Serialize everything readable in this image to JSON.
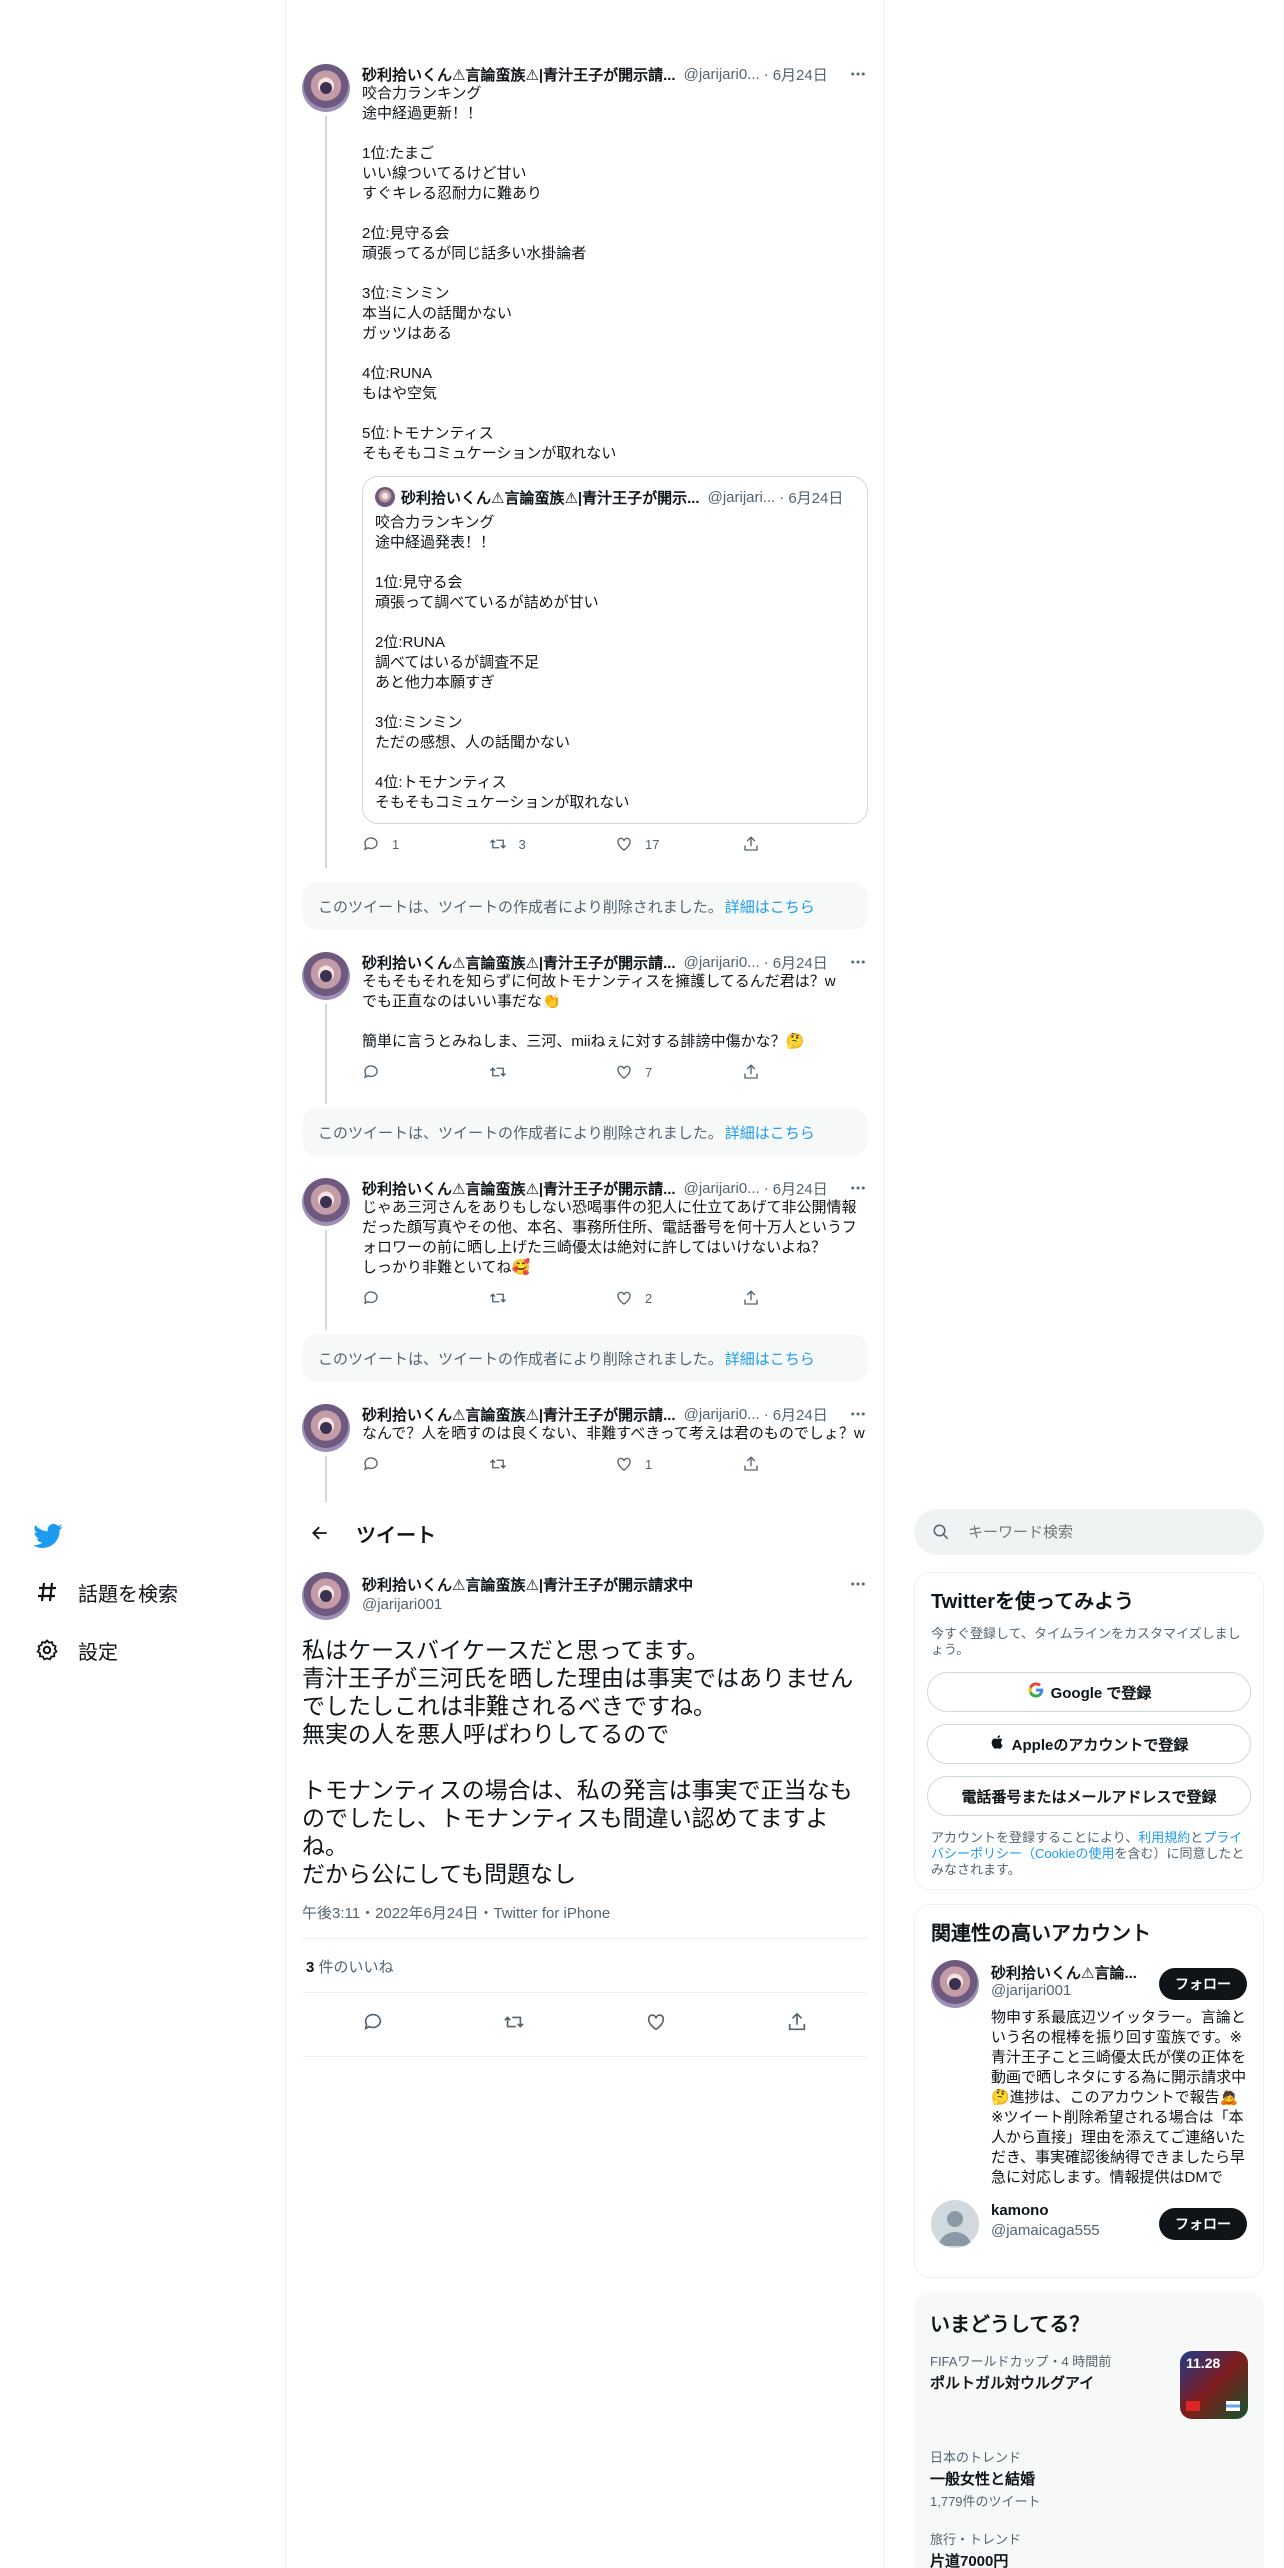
{
  "nav": {
    "explore_label": "話題を検索",
    "settings_label": "設定"
  },
  "thread": [
    {
      "name": "砂利拾いくん⚠言論蛮族⚠|青汁王子が開示請...",
      "handle": "@jarijari0...",
      "date": "6月24日",
      "text": "咬合力ランキング\n途中経過更新！！\n\n1位:たまご\nいい線ついてるけど甘い\nすぐキレる忍耐力に難あり\n\n2位:見守る会\n頑張ってるが同じ話多い水掛論者\n\n3位:ミンミン\n本当に人の話聞かない\nガッツはある\n\n4位:RUNA\nもはや空気\n\n5位:トモナンティス\nそもそもコミュケーションが取れない",
      "quote": {
        "name": "砂利拾いくん⚠言論蛮族⚠|青汁王子が開示...",
        "handle": "@jarijari...",
        "date": "6月24日",
        "text": "咬合力ランキング\n途中経過発表！！\n\n1位:見守る会\n頑張って調べているが詰めが甘い\n\n2位:RUNA\n調べてはいるが調査不足\nあと他力本願すぎ\n\n3位:ミンミン\nただの感想、人の話聞かない\n\n4位:トモナンティス\nそもそもコミュケーションが取れない"
      },
      "replies": "1",
      "retweets": "3",
      "likes": "17"
    },
    {
      "name": "砂利拾いくん⚠言論蛮族⚠|青汁王子が開示請...",
      "handle": "@jarijari0...",
      "date": "6月24日",
      "text": "そもそもそれを知らずに何故トモナンティスを擁護してるんだ君は？w\nでも正直なのはいい事だな👏\n\n簡単に言うとみねしま、三河、miiねぇに対する誹謗中傷かな？🤔",
      "replies": "",
      "retweets": "",
      "likes": "7"
    },
    {
      "name": "砂利拾いくん⚠言論蛮族⚠|青汁王子が開示請...",
      "handle": "@jarijari0...",
      "date": "6月24日",
      "text": "じゃあ三河さんをありもしない恐喝事件の犯人に仕立てあげて非公開情報だった顔写真やその他、本名、事務所住所、電話番号を何十万人というフォロワーの前に晒し上げた三崎優太は絶対に許してはいけないよね？\nしっかり非難といてね🥰",
      "replies": "",
      "retweets": "",
      "likes": "2"
    },
    {
      "name": "砂利拾いくん⚠言論蛮族⚠|青汁王子が開示請...",
      "handle": "@jarijari0...",
      "date": "6月24日",
      "text": "なんで？人を晒すのは良くない、非難すべきって考えは君のものでしょ？w",
      "replies": "",
      "retweets": "",
      "likes": "1"
    }
  ],
  "deleted_notice": {
    "text": "このツイートは、ツイートの作成者により削除されました。",
    "link": "詳細はこちら"
  },
  "detail": {
    "header_title": "ツイート",
    "name": "砂利拾いくん⚠言論蛮族⚠|青汁王子が開示請求中",
    "handle": "@jarijari001",
    "text": "私はケースバイケースだと思ってます。\n青汁王子が三河氏を晒した理由は事実ではありませんでしたしこれは非難されるべきですね。\n無実の人を悪人呼ばわりしてるので\n\nトモナンティスの場合は、私の発言は事実で正当なものでしたし、トモナンティスも間違い認めてますよね。\nだから公にしても問題なし",
    "meta": "午後3:11・2022年6月24日・Twitter for iPhone",
    "like_count": "3",
    "like_label": " 件のいいね"
  },
  "sidebar": {
    "search_placeholder": "キーワード検索",
    "signup": {
      "title": "Twitterを使ってみよう",
      "subtitle": "今すぐ登録して、タイムラインをカスタマイズしましょう。",
      "google": "Google で登録",
      "apple": "Appleのアカウントで登録",
      "phone": "電話番号またはメールアドレスで登録",
      "terms_pre": "アカウントを登録することにより、",
      "terms_link1": "利用規約",
      "terms_mid": "と",
      "terms_link2": "プライバシーポリシー（Cookieの使用",
      "terms_post": "を含む）に同意したとみなされます。"
    },
    "related": {
      "title": "関連性の高いアカウント",
      "accounts": [
        {
          "name": "砂利拾いくん⚠言論...",
          "handle": "@jarijari001",
          "follow": "フォロー",
          "bio": "物申す系最底辺ツイッタラー。言論という名の棍棒を振り回す蛮族です。※青汁王子こと三崎優太氏が僕の正体を動画で晒しネタにする為に開示請求中🤔進捗は、このアカウントで報告🙇※ツイート削除希望される場合は「本人から直接」理由を添えてご連絡いただき、事実確認後納得できましたら早急に対応します。情報提供はDMで"
        },
        {
          "name": "kamono",
          "handle": "@jamaicaga555",
          "follow": "フォロー",
          "bio": ""
        }
      ]
    },
    "trends": {
      "title": "いまどうしてる？",
      "items": [
        {
          "meta": "FIFAワールドカップ・4 時間前",
          "title": "ポルトガル対ウルグアイ",
          "count": "",
          "image_text": "11.28"
        },
        {
          "meta": "日本のトレンド",
          "title": "一般女性と結婚",
          "count": "1,779件のツイート"
        },
        {
          "meta": "旅行・トレンド",
          "title": "片道7000円",
          "count": ""
        }
      ]
    }
  },
  "colors": {
    "brand": "#1d9bf0",
    "text": "#0f1419",
    "muted": "#536471",
    "border": "#eff3f4"
  }
}
